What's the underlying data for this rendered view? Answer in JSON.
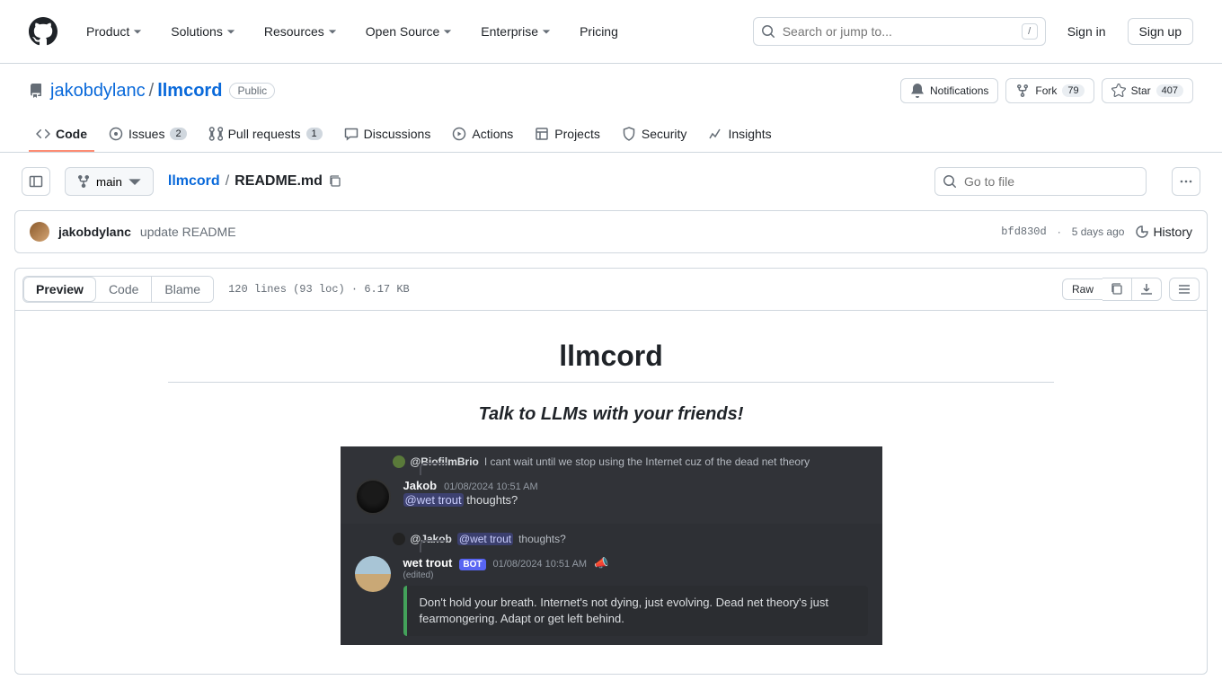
{
  "header": {
    "nav": [
      "Product",
      "Solutions",
      "Resources",
      "Open Source",
      "Enterprise",
      "Pricing"
    ],
    "search_placeholder": "Search or jump to...",
    "search_key": "/",
    "sign_in": "Sign in",
    "sign_up": "Sign up"
  },
  "repo": {
    "owner": "jakobdylanc",
    "name": "llmcord",
    "visibility": "Public",
    "actions": {
      "notifications": "Notifications",
      "fork": "Fork",
      "fork_count": "79",
      "star": "Star",
      "star_count": "407"
    }
  },
  "tabs": {
    "code": "Code",
    "issues": "Issues",
    "issues_count": "2",
    "pulls": "Pull requests",
    "pulls_count": "1",
    "discussions": "Discussions",
    "actions": "Actions",
    "projects": "Projects",
    "security": "Security",
    "insights": "Insights"
  },
  "file_nav": {
    "branch": "main",
    "breadcrumb_root": "llmcord",
    "breadcrumb_file": "README.md",
    "go_to_file": "Go to file"
  },
  "commit": {
    "author": "jakobdylanc",
    "message": "update README",
    "sha": "bfd830d",
    "sep": "·",
    "time": "5 days ago",
    "history": "History"
  },
  "toolbar": {
    "preview": "Preview",
    "code": "Code",
    "blame": "Blame",
    "file_info": "120 lines (93 loc) · 6.17 KB",
    "raw": "Raw"
  },
  "readme": {
    "title": "llmcord",
    "tagline": "Talk to LLMs with your friends!"
  },
  "discord": {
    "msg1": {
      "reply_user": "@BiofilmBrio",
      "reply_text": "I cant wait until we stop using the Internet cuz of the dead net theory",
      "user": "Jakob",
      "time": "01/08/2024 10:51 AM",
      "mention": "@wet trout",
      "text": "thoughts?"
    },
    "msg2": {
      "reply_user": "@Jakob",
      "reply_mention": "@wet trout",
      "reply_text": "thoughts?",
      "user": "wet trout",
      "bot": "BOT",
      "time": "01/08/2024 10:51 AM",
      "edited": "(edited)",
      "embed": "Don't hold your breath. Internet's not dying, just evolving. Dead net theory's just fearmongering. Adapt or get left behind."
    }
  }
}
